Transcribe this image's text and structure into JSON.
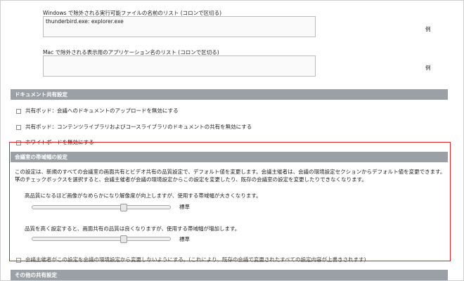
{
  "windows_exclusion": {
    "label": "Windows で除外される実行可能ファイルの名前のリスト (コロンで区切る)",
    "value": "thunderbird.exe: explorer.exe",
    "example": "例"
  },
  "mac_exclusion": {
    "label": "Mac で除外される表示用のアプリケーション名のリスト (コロンで区切る)",
    "value": "",
    "example": "例"
  },
  "document_sharing": {
    "header": "ドキュメント共有設定",
    "options": [
      {
        "label": "共有ポッド：会議へのドキュメントのアップロードを無効にする",
        "checked": false
      },
      {
        "label": "共有ポッド：コンテンツライブラリおよびコースライブラリのドキュメントの共有を無効にする",
        "checked": false
      },
      {
        "label": "ホワイトボードを無効にする",
        "checked": false
      }
    ]
  },
  "bandwidth": {
    "header": "会議室の帯域幅の設定",
    "description_line1": "この設定は、新規のすべての会議室の画面共有とビデオ共有の品質設定で、デフォルト値を変更します。会議主催者は、会議の環境設定セクションからデフォルト値を変更できます。以",
    "description_line2": "下のチェックボックスを選択すると、会議主催者が会議の環境設定からこの設定を変更したり、既存の会議室の設定を変更したりできなくなります。",
    "video_text": "高品質になるほど画像がなめらかになり解像度が向上しますが、使用する帯域幅が大きくなります。",
    "video_value_label": "標準",
    "video_level": 0.67,
    "screen_text": "品質を高く設定すると、画面共有の品質は良くなりますが、使用する帯域幅が増加します。",
    "screen_value_label": "標準",
    "screen_level": 0.67,
    "lock_option": "会議主催者がこの設定を会議の環境設定から変更しないようにする。(これにより、既存の会議で変更されたすべての設定内容が上書きされます)"
  },
  "other_sharing": {
    "header": "その他の共有設定"
  }
}
